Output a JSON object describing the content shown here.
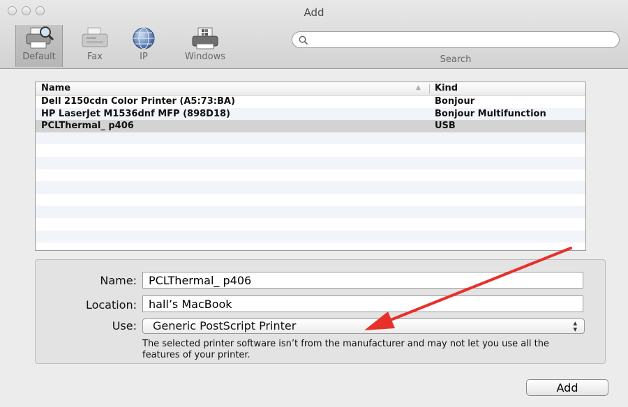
{
  "window": {
    "title": "Add"
  },
  "toolbar": {
    "tools": [
      {
        "label": "Default",
        "icon": "printer-magnifier-icon"
      },
      {
        "label": "Fax",
        "icon": "fax-icon"
      },
      {
        "label": "IP",
        "icon": "globe-icon"
      },
      {
        "label": "Windows",
        "icon": "windows-printer-icon"
      }
    ],
    "search": {
      "label": "Search",
      "value": "",
      "placeholder": ""
    }
  },
  "printer_list": {
    "columns": [
      "Name",
      "Kind"
    ],
    "rows": [
      {
        "name": "Dell 2150cdn Color Printer (A5:73:BA)",
        "kind": "Bonjour"
      },
      {
        "name": "HP LaserJet M1536dnf MFP (898D18)",
        "kind": "Bonjour Multifunction"
      },
      {
        "name": "PCLThermal_ p406",
        "kind": "USB",
        "selected": true
      }
    ]
  },
  "details": {
    "name_label": "Name:",
    "name_value": "PCLThermal_ p406",
    "location_label": "Location:",
    "location_value": "hall’s MacBook",
    "use_label": "Use:",
    "use_value": "Generic PostScript Printer",
    "note": "The selected printer software isn’t from the manufacturer and may not let you use all the features of your printer."
  },
  "buttons": {
    "add": "Add"
  },
  "colors": {
    "annotation_arrow": "#e8302a",
    "selected_row": "#d3d3d3"
  }
}
